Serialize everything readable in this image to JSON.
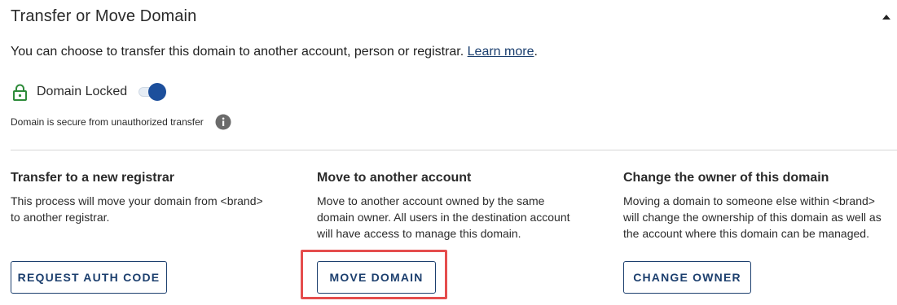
{
  "section": {
    "title": "Transfer or Move Domain",
    "description": "You can choose to transfer this domain to another account, person or registrar.",
    "learn_more": "Learn more",
    "description_end": "."
  },
  "lock": {
    "label": "Domain Locked",
    "enabled": true,
    "secure_text": "Domain is secure from unauthorized transfer",
    "lock_color": "#2e8b3a",
    "toggle_color": "#1c4f9c"
  },
  "options": [
    {
      "title": "Transfer to a new registrar",
      "body": "This process will move your domain from <brand>\nto another registrar.",
      "button": "REQUEST AUTH CODE"
    },
    {
      "title": "Move to another account",
      "body": "Move to another account owned by the same\ndomain owner. All users in the destination account\nwill have access to manage this domain.",
      "button": "MOVE DOMAIN"
    },
    {
      "title": "Change the owner of this domain",
      "body": "Moving a domain to someone else within <brand>\nwill change the ownership of this domain as well as\nthe account where this domain can be managed.",
      "button": "CHANGE OWNER"
    }
  ],
  "icons": {
    "collapse": "caret-up-icon",
    "lock": "padlock-icon",
    "info": "info-icon"
  },
  "colors": {
    "accent": "#1c3f6e",
    "highlight": "#e54d4d"
  }
}
